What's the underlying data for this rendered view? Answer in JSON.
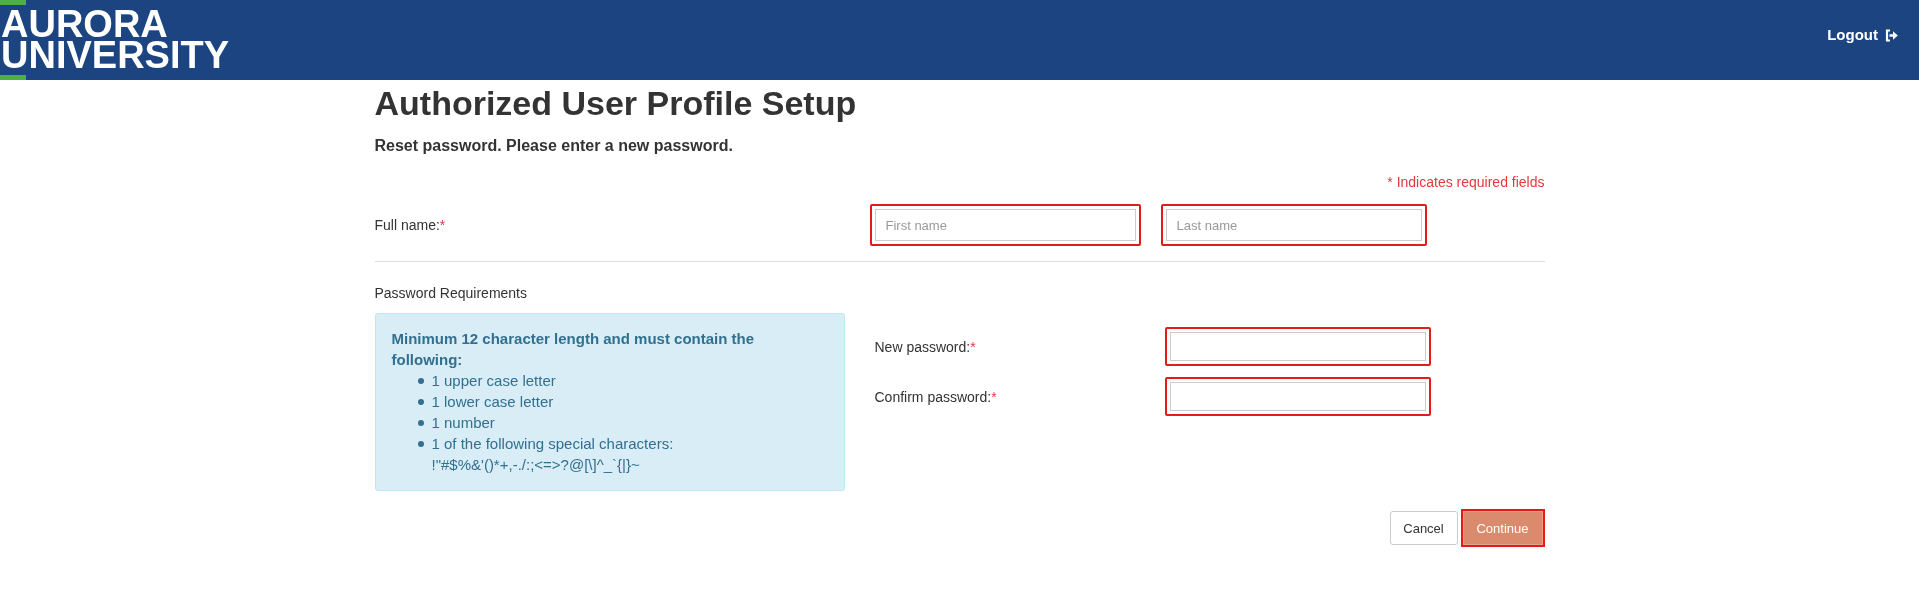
{
  "header": {
    "logo_lines": [
      "AURORA",
      "UNIVERSITY"
    ],
    "logout": "Logout"
  },
  "title": "Authorized User Profile Setup",
  "subtitle": "Reset password. Please enter a new password.",
  "required_note": "* Indicates required fields",
  "full_name": {
    "label": "Full name:",
    "required_mark": "*",
    "fields": [
      {
        "placeholder": "First name",
        "highlighted": true
      },
      {
        "placeholder": "Last name",
        "highlighted": true
      }
    ]
  },
  "password_requirements": {
    "heading": "Password Requirements",
    "intro": "Minimum 12 character length and must contain the following:",
    "items": [
      {
        "text": "1 upper case letter"
      },
      {
        "text": "1 lower case letter"
      },
      {
        "text": "1 number"
      },
      {
        "text": "1 of the following special characters:",
        "detail": "!\"#$%&'()*+,-./:;<=>?@[\\]^_`{|}~"
      }
    ]
  },
  "password_fields": [
    {
      "label": "New password:",
      "required_mark": "*",
      "highlighted": true
    },
    {
      "label": "Confirm password:",
      "required_mark": "*",
      "highlighted": true
    }
  ],
  "buttons": [
    {
      "label": "Cancel",
      "kind": "default",
      "highlighted": false
    },
    {
      "label": "Continue",
      "kind": "primary",
      "highlighted": true
    }
  ]
}
